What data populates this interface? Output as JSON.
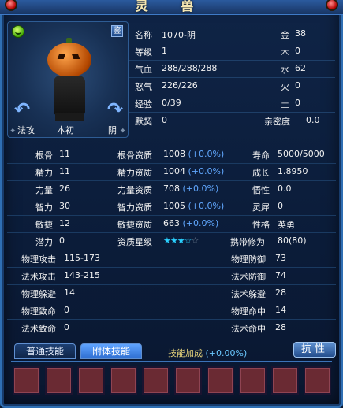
{
  "window": {
    "title": "灵 兽"
  },
  "portrait": {
    "labels": {
      "left": "法攻",
      "center": "本初",
      "right": "阴"
    },
    "appraise_label": "鉴"
  },
  "info": [
    {
      "k1": "名称",
      "v1": "1070-阴",
      "k2": "金",
      "v2": "38"
    },
    {
      "k1": "等级",
      "v1": "1",
      "k2": "木",
      "v2": "0"
    },
    {
      "k1": "气血",
      "v1": "288/288/288",
      "k2": "水",
      "v2": "62"
    },
    {
      "k1": "怒气",
      "v1": "226/226",
      "k2": "火",
      "v2": "0"
    },
    {
      "k1": "经验",
      "v1": "0/39",
      "k2": "土",
      "v2": "0"
    },
    {
      "k1": "默契",
      "v1": "0",
      "k2": "亲密度",
      "v2": "0.0"
    }
  ],
  "attributes": [
    {
      "k1": "根骨",
      "v1": "11",
      "k2": "根骨资质",
      "v2": "1008",
      "p2": "(+0.0%)",
      "k3": "寿命",
      "v3": "5000/5000"
    },
    {
      "k1": "精力",
      "v1": "11",
      "k2": "精力资质",
      "v2": "1004",
      "p2": "(+0.0%)",
      "k3": "成长",
      "v3": "1.8950"
    },
    {
      "k1": "力量",
      "v1": "26",
      "k2": "力量资质",
      "v2": "708",
      "p2": "(+0.0%)",
      "k3": "悟性",
      "v3": "0.0"
    },
    {
      "k1": "智力",
      "v1": "30",
      "k2": "智力资质",
      "v2": "1005",
      "p2": "(+0.0%)",
      "k3": "灵犀",
      "v3": "0"
    },
    {
      "k1": "敏捷",
      "v1": "12",
      "k2": "敏捷资质",
      "v2": "663",
      "p2": "(+0.0%)",
      "k3": "性格",
      "v3": "英勇"
    },
    {
      "k1": "潜力",
      "v1": "0",
      "k2": "资质星级",
      "v2": "",
      "p2": "",
      "k3": "携带修为",
      "v3": "80(80)"
    }
  ],
  "star_rating": {
    "filled": 3.5,
    "total": 5
  },
  "combat": [
    {
      "k1": "物理攻击",
      "v1": "115-173",
      "k2": "物理防御",
      "v2": "73"
    },
    {
      "k1": "法术攻击",
      "v1": "143-215",
      "k2": "法术防御",
      "v2": "74"
    },
    {
      "k1": "物理躲避",
      "v1": "14",
      "k2": "法术躲避",
      "v2": "28"
    },
    {
      "k1": "物理致命",
      "v1": "0",
      "k2": "物理命中",
      "v2": "14"
    },
    {
      "k1": "法术致命",
      "v1": "0",
      "k2": "法术命中",
      "v2": "28"
    }
  ],
  "tabs": {
    "normal": "普通技能",
    "attached": "附体技能"
  },
  "skill_bonus": {
    "label": "技能加成",
    "value": "(+0.00%)"
  },
  "resist_button": "抗性",
  "slot_count": 10
}
